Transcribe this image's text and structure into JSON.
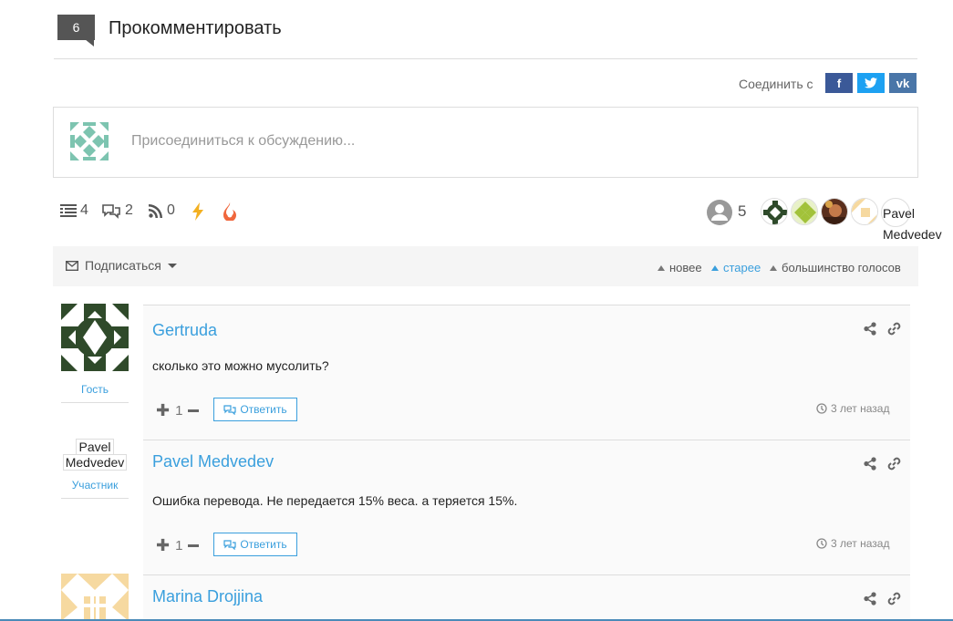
{
  "header": {
    "count": "6",
    "title": "Прокомментировать"
  },
  "connect": {
    "label": "Соединить с",
    "facebook": "f",
    "twitter": "t",
    "vk": "vk"
  },
  "join": {
    "placeholder": "Присоединиться к обсуждению..."
  },
  "stats": {
    "threads": "4",
    "replies": "2",
    "followers": "0",
    "participants": "5"
  },
  "participants": {
    "last_name_line1": "Pavel",
    "last_name_line2": "Medvedev"
  },
  "subscribe": {
    "label": "Подписаться"
  },
  "sort": {
    "newest": "новее",
    "oldest": "старее",
    "most_voted": "большинство голосов",
    "active": "oldest"
  },
  "comments": [
    {
      "author": "Gertruda",
      "role": "Гость",
      "text": "сколько это можно мусолить?",
      "votes": "1",
      "reply_label": "Ответить",
      "time": "3 лет назад"
    },
    {
      "author": "Pavel Medvedev",
      "avatar_line1": "Pavel",
      "avatar_line2": "Medvedev",
      "role": "Участник",
      "text": "Ошибка перевода. Не передается 15% веса. а теряется 15%.",
      "votes": "1",
      "reply_label": "Ответить",
      "time": "3 лет назад"
    },
    {
      "author": "Marina Drojjina"
    }
  ],
  "colors": {
    "accent": "#3a9fdd",
    "badge": "#555555",
    "facebook": "#3b5998",
    "twitter": "#1da1f2",
    "vk": "#4a76a8"
  }
}
